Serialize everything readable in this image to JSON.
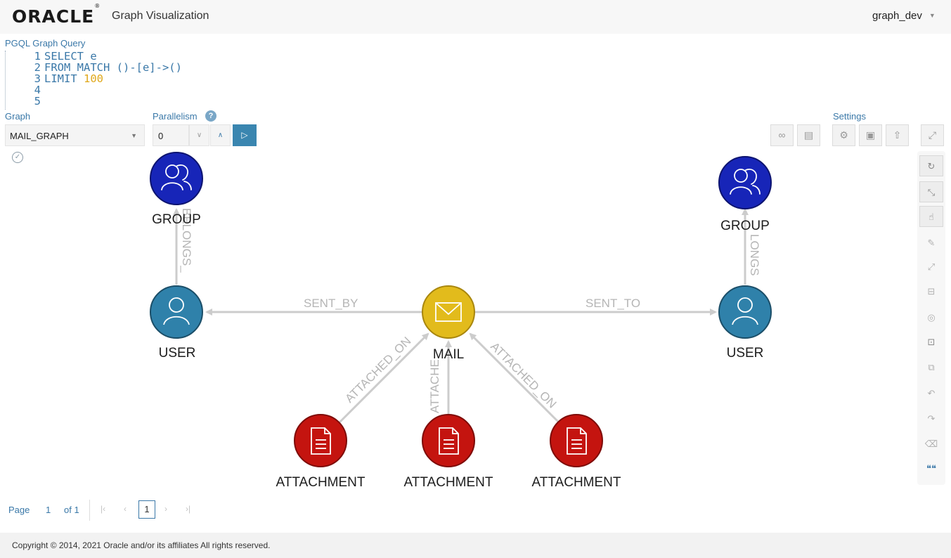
{
  "header": {
    "logo": "ORACLE",
    "logo_mark": "®",
    "app_title": "Graph Visualization",
    "user": "graph_dev"
  },
  "query": {
    "label": "PGQL Graph Query",
    "lines": [
      {
        "n": "1",
        "text": "SELECT e"
      },
      {
        "n": "2",
        "text": "FROM MATCH ()-[e]->()"
      },
      {
        "n": "3",
        "kw": "LIMIT ",
        "num": "100"
      },
      {
        "n": "4",
        "text": ""
      },
      {
        "n": "5",
        "text": ""
      }
    ]
  },
  "controls": {
    "graph_label": "Graph",
    "graph_value": "MAIL_GRAPH",
    "parallelism_label": "Parallelism",
    "parallelism_value": "0",
    "help_glyph": "?",
    "settings_label": "Settings"
  },
  "graph": {
    "nodes": [
      {
        "id": "g1",
        "label": "GROUP",
        "type": "group",
        "color": "#1725b8"
      },
      {
        "id": "g2",
        "label": "GROUP",
        "type": "group",
        "color": "#1725b8"
      },
      {
        "id": "u1",
        "label": "USER",
        "type": "user",
        "color": "#2f81aa"
      },
      {
        "id": "u2",
        "label": "USER",
        "type": "user",
        "color": "#2f81aa"
      },
      {
        "id": "m",
        "label": "MAIL",
        "type": "mail",
        "color": "#e2bb1c"
      },
      {
        "id": "a1",
        "label": "ATTACHMENT",
        "type": "attachment",
        "color": "#c4140f"
      },
      {
        "id": "a2",
        "label": "ATTACHMENT",
        "type": "attachment",
        "color": "#c4140f"
      },
      {
        "id": "a3",
        "label": "ATTACHMENT",
        "type": "attachment",
        "color": "#c4140f"
      }
    ],
    "edges": [
      {
        "from": "u1",
        "to": "g1",
        "label": "BELONGS_"
      },
      {
        "from": "u2",
        "to": "g2",
        "label": "LONGS"
      },
      {
        "from": "m",
        "to": "u1",
        "label": "SENT_BY"
      },
      {
        "from": "m",
        "to": "u2",
        "label": "SENT_TO"
      },
      {
        "from": "a1",
        "to": "m",
        "label": "ATTACHED_ON"
      },
      {
        "from": "a2",
        "to": "m",
        "label": "ATTACHE"
      },
      {
        "from": "a3",
        "to": "m",
        "label": "ATTACHED_ON"
      }
    ]
  },
  "pager": {
    "page_label": "Page",
    "page_num": "1",
    "of_label": "of 1",
    "current": "1"
  },
  "footer": {
    "copyright": "Copyright © 2014, 2021 Oracle and/or its affiliates All rights reserved."
  }
}
